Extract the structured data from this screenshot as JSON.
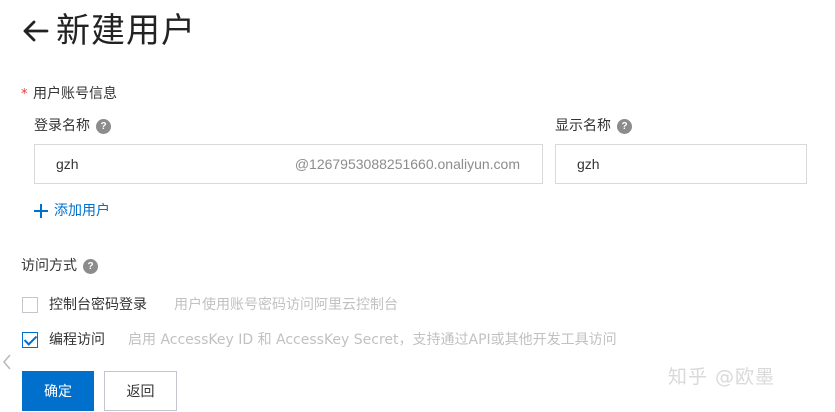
{
  "header": {
    "title": "新建用户"
  },
  "account_section": {
    "required_mark": "*",
    "title": "用户账号信息",
    "login_name": {
      "label": "登录名称",
      "value": "gzh",
      "suffix": "@1267953088251660.onaliyun.com"
    },
    "display_name": {
      "label": "显示名称",
      "value": "gzh"
    },
    "help_glyph": "?",
    "add_user_label": "添加用户"
  },
  "access_section": {
    "title": "访问方式",
    "console": {
      "label": "控制台密码登录",
      "desc": "用户使用账号密码访问阿里云控制台",
      "checked": false
    },
    "programmatic": {
      "label": "编程访问",
      "desc": "启用 AccessKey ID 和 AccessKey Secret，支持通过API或其他开发工具访问",
      "checked": true
    }
  },
  "buttons": {
    "confirm": "确定",
    "back": "返回"
  },
  "watermark": "知乎 @欧墨",
  "colors": {
    "primary": "#0070cc",
    "required": "#e6393a",
    "desc_text": "#c1c1c1",
    "border": "#d9d9d9"
  },
  "icons": [
    "arrow-left-icon",
    "help-icon",
    "plus-icon",
    "check-icon",
    "chevron-left-icon"
  ]
}
